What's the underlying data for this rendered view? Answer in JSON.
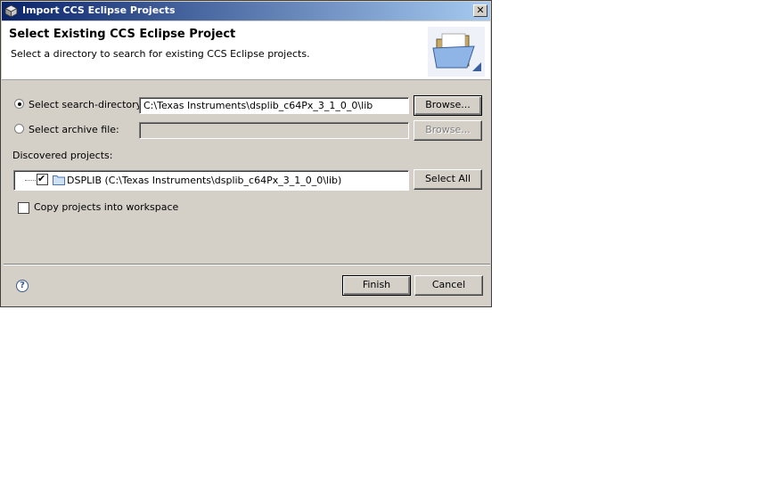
{
  "window": {
    "title": "Import CCS Eclipse Projects",
    "close_label": "✕"
  },
  "header": {
    "title": "Select Existing CCS Eclipse Project",
    "description": "Select a directory to search for existing CCS Eclipse projects."
  },
  "source": {
    "search_directory": {
      "label": "Select search-directory:",
      "value": "C:\\Texas Instruments\\dsplib_c64Px_3_1_0_0\\lib",
      "selected": true
    },
    "archive_file": {
      "label": "Select archive file:",
      "value": "",
      "selected": false
    },
    "browse_label": "Browse...",
    "browse_disabled_label": "Browse..."
  },
  "projects": {
    "label": "Discovered projects:",
    "items": [
      {
        "label": "DSPLIB  (C:\\Texas Instruments\\dsplib_c64Px_3_1_0_0\\lib)",
        "checked": true
      }
    ],
    "select_all_label": "Select All"
  },
  "options": {
    "copy_label": "Copy projects into workspace",
    "copy_checked": false
  },
  "footer": {
    "help_symbol": "?",
    "finish_label": "Finish",
    "cancel_label": "Cancel"
  },
  "colors": {
    "titlebar_start": "#0a246a",
    "titlebar_end": "#a6caf0",
    "dialog_bg": "#d4d0c8"
  }
}
